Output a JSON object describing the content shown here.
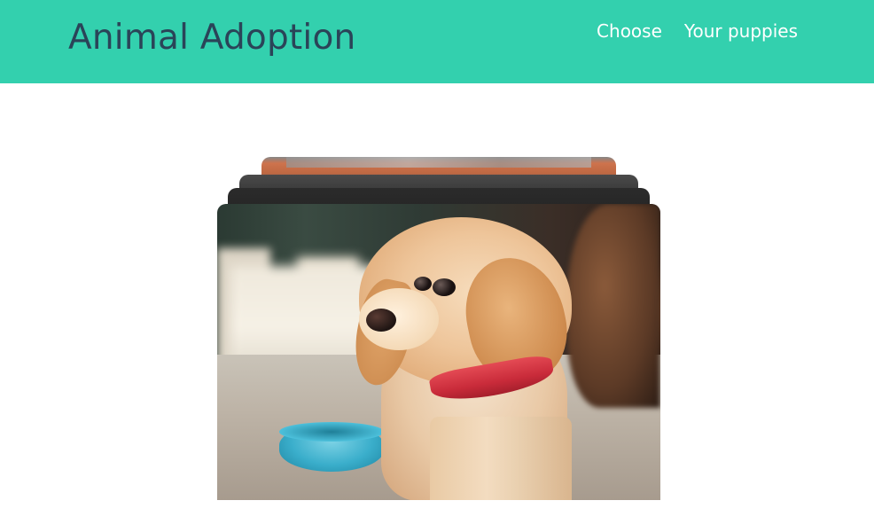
{
  "header": {
    "brand": "Animal Adoption",
    "nav": [
      {
        "label": "Choose"
      },
      {
        "label": "Your puppies"
      }
    ]
  },
  "colors": {
    "navbar_bg": "#33d0ae",
    "brand_text": "#2a4458",
    "nav_text": "#ffffff"
  },
  "cards": {
    "front_image": "golden-retriever-puppy-photo",
    "stack_count": 4
  }
}
